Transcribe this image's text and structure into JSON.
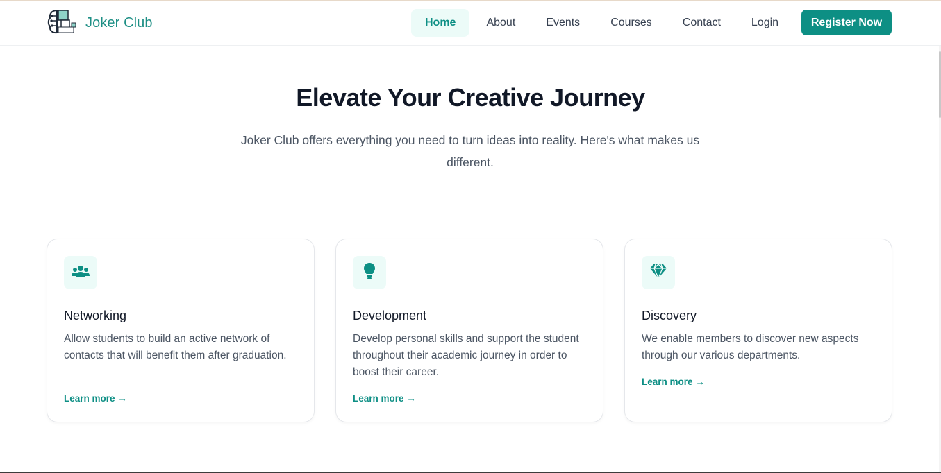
{
  "header": {
    "brand": "Joker Club",
    "logo_icon": "brain-circuit-icon",
    "nav": [
      {
        "label": "Home",
        "active": true
      },
      {
        "label": "About"
      },
      {
        "label": "Events"
      },
      {
        "label": "Courses"
      },
      {
        "label": "Contact"
      },
      {
        "label": "Login"
      }
    ],
    "register_label": "Register Now"
  },
  "hero": {
    "title": "Elevate Your Creative Journey",
    "subtitle": "Joker Club offers everything you need to turn ideas into reality. Here's what makes us different."
  },
  "features": [
    {
      "icon": "users-icon",
      "title": "Networking",
      "description": "Allow students to build an active network of contacts that will benefit them after graduation.",
      "link": "Learn more →"
    },
    {
      "icon": "lightbulb-icon",
      "title": "Development",
      "description": "Develop personal skills and support the student throughout their academic journey in order to boost their career.",
      "link": "Learn more →"
    },
    {
      "icon": "gem-icon",
      "title": "Discovery",
      "description": "We enable members to discover new aspects through our various departments.",
      "link": "Learn more →"
    }
  ],
  "colors": {
    "accent": "#0d8f84",
    "accent_light": "#ecfbf8",
    "heading": "#111827",
    "body_text": "#4b5563"
  }
}
